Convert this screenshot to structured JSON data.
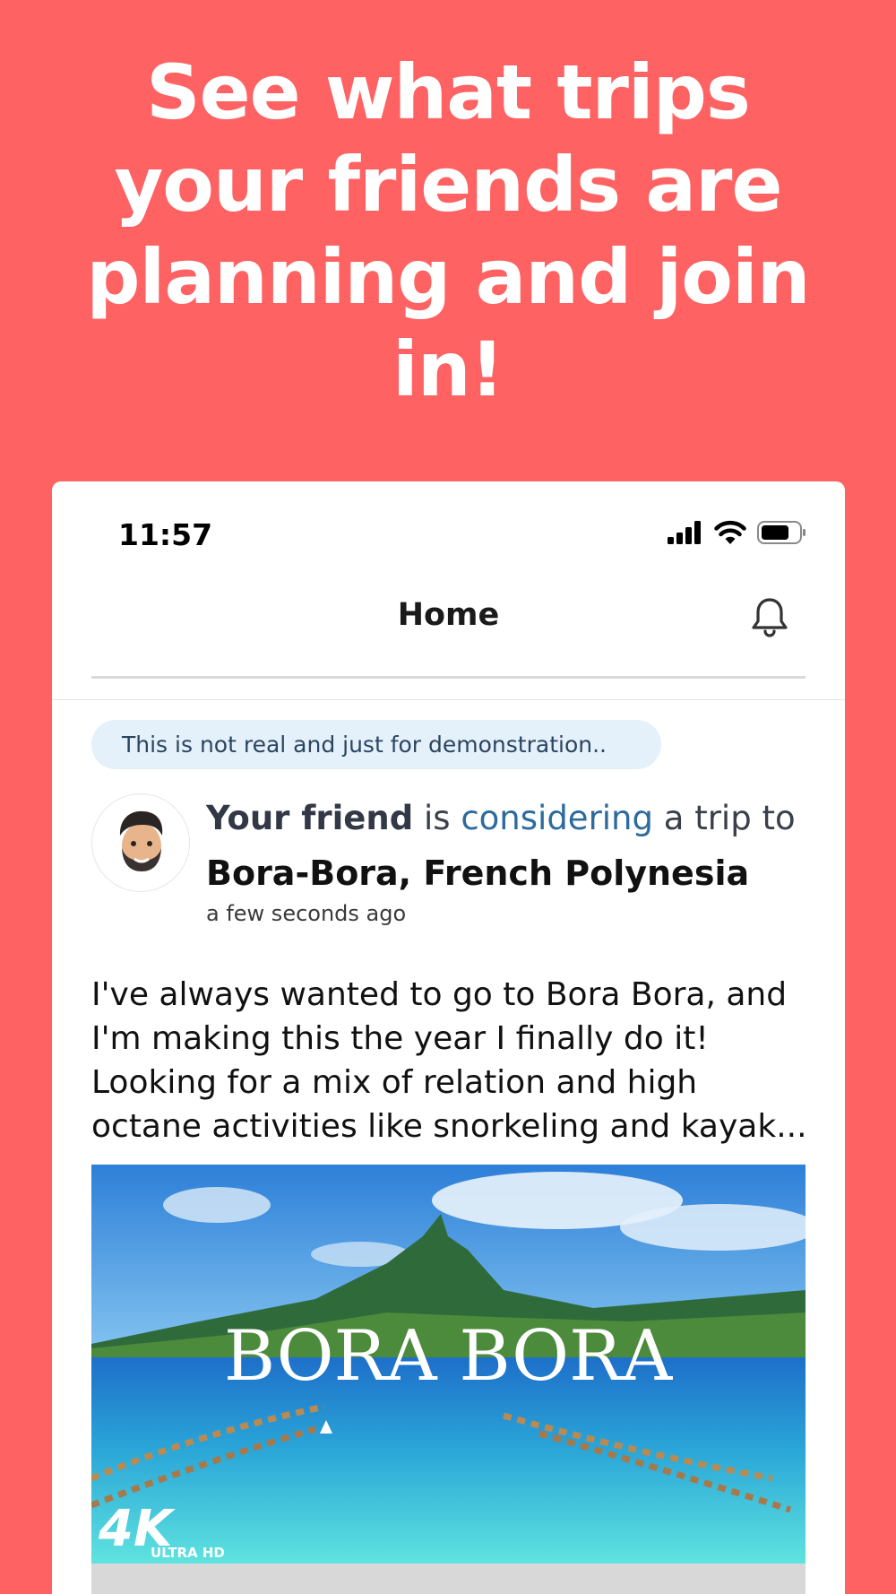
{
  "headline": "See what trips your friends are planning and join in!",
  "status_bar": {
    "time": "11:57",
    "icons": [
      "signal-icon",
      "wifi-icon",
      "battery-icon"
    ]
  },
  "nav": {
    "title": "Home",
    "right_icon": "bell-icon"
  },
  "notice": "This is not real and just for demonstration..",
  "post": {
    "author": "Your friend",
    "verb": "is",
    "status": "considering",
    "suffix": "a trip to",
    "destination": "Bora-Bora, French Polynesia",
    "time": "a few seconds ago",
    "body": "I've always wanted to go to Bora Bora, and I'm making this the year I finally do it! Looking for a mix of relation and high octane activities like snorkeling and kayak...",
    "image": {
      "overlay_title": "BORA BORA",
      "badge_main": "4K",
      "badge_sub": "ULTRA HD"
    }
  },
  "colors": {
    "background": "#fe6262",
    "status_link": "#2d6a9d",
    "notice_bg": "#e4f0fa"
  }
}
